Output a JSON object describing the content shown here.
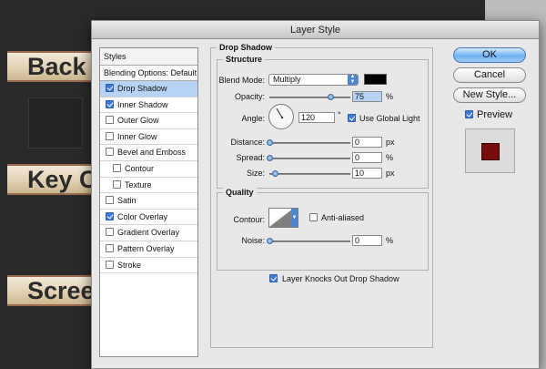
{
  "background": {
    "banners": [
      "Back",
      "Key C",
      "Scree"
    ]
  },
  "dialog": {
    "title": "Layer Style"
  },
  "styles_panel": {
    "header": "Styles",
    "blending_options": "Blending Options: Default",
    "items": [
      {
        "label": "Drop Shadow",
        "checked": true,
        "selected": true
      },
      {
        "label": "Inner Shadow",
        "checked": true
      },
      {
        "label": "Outer Glow",
        "checked": false
      },
      {
        "label": "Inner Glow",
        "checked": false
      },
      {
        "label": "Bevel and Emboss",
        "checked": false
      },
      {
        "label": "Contour",
        "checked": false,
        "sub": true
      },
      {
        "label": "Texture",
        "checked": false,
        "sub": true
      },
      {
        "label": "Satin",
        "checked": false
      },
      {
        "label": "Color Overlay",
        "checked": true
      },
      {
        "label": "Gradient Overlay",
        "checked": false
      },
      {
        "label": "Pattern Overlay",
        "checked": false
      },
      {
        "label": "Stroke",
        "checked": false
      }
    ]
  },
  "drop_shadow": {
    "section_title": "Drop Shadow",
    "structure": {
      "title": "Structure",
      "blend_mode_label": "Blend Mode:",
      "blend_mode_value": "Multiply",
      "shadow_color": "#000000",
      "opacity_label": "Opacity:",
      "opacity_value": "75",
      "opacity_unit": "%",
      "angle_label": "Angle:",
      "angle_value": "120",
      "angle_unit": "°",
      "use_global_light_label": "Use Global Light",
      "use_global_light_checked": true,
      "distance_label": "Distance:",
      "distance_value": "0",
      "distance_unit": "px",
      "spread_label": "Spread:",
      "spread_value": "0",
      "spread_unit": "%",
      "size_label": "Size:",
      "size_value": "10",
      "size_unit": "px"
    },
    "quality": {
      "title": "Quality",
      "contour_label": "Contour:",
      "anti_aliased_label": "Anti-aliased",
      "anti_aliased_checked": false,
      "noise_label": "Noise:",
      "noise_value": "0",
      "noise_unit": "%"
    },
    "knockout_label": "Layer Knocks Out Drop Shadow",
    "knockout_checked": true
  },
  "buttons": {
    "ok": "OK",
    "cancel": "Cancel",
    "new_style": "New Style...",
    "preview_label": "Preview",
    "preview_checked": true,
    "preview_color": "#7a0c0c"
  }
}
